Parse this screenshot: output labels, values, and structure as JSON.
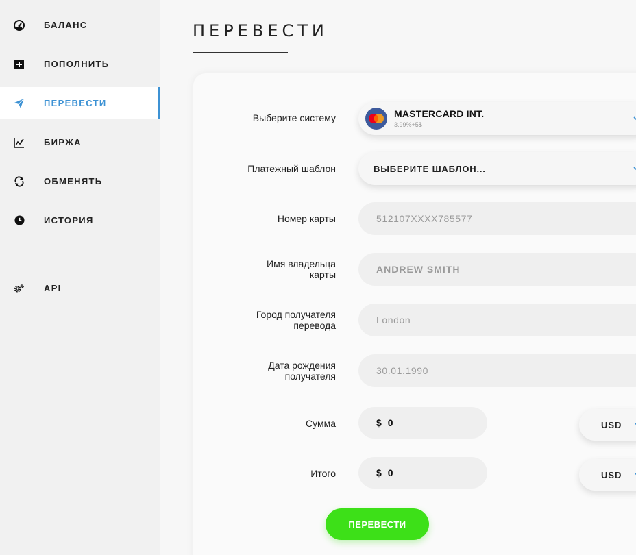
{
  "sidebar": {
    "items": [
      {
        "label": "БАЛАНС",
        "icon": "dashboard-icon"
      },
      {
        "label": "ПОПОЛНИТЬ",
        "icon": "plus-square-icon"
      },
      {
        "label": "ПЕРЕВЕСТИ",
        "icon": "paper-plane-icon",
        "active": true
      },
      {
        "label": "БИРЖА",
        "icon": "chart-line-icon"
      },
      {
        "label": "ОБМЕНЯТЬ",
        "icon": "refresh-icon"
      },
      {
        "label": "ИСТОРИЯ",
        "icon": "clock-icon"
      },
      {
        "label": "API",
        "icon": "gears-icon"
      }
    ]
  },
  "page": {
    "title": "ПЕРЕВЕСТИ"
  },
  "form": {
    "system_label": "Выберите систему",
    "system_name": "MASTERCARD INT.",
    "system_fee": "3.99%+5$",
    "system_logo_text": "MasterCard",
    "template_label": "Платежный шаблон",
    "template_value": "ВЫБЕРИТЕ ШАБЛОН...",
    "card_number_label": "Номер карты",
    "card_number_placeholder": "512107XXXX785577",
    "card_holder_label_1": "Имя владельца",
    "card_holder_label_2": "карты",
    "card_holder_placeholder": "ANDREW SMITH",
    "city_label_1": "Город получателя",
    "city_label_2": "перевода",
    "city_placeholder": "London",
    "dob_label_1": "Дата рождения",
    "dob_label_2": "получателя",
    "dob_placeholder": "30.01.1990",
    "amount_label": "Сумма",
    "amount_sign": "$",
    "amount_value": "0",
    "amount_currency": "USD",
    "total_label": "Итого",
    "total_sign": "$",
    "total_value": "0",
    "total_currency": "USD",
    "submit_label": "ПЕРЕВЕСТИ"
  },
  "colors": {
    "accent": "#3d92d4",
    "submit": "#3de018"
  }
}
